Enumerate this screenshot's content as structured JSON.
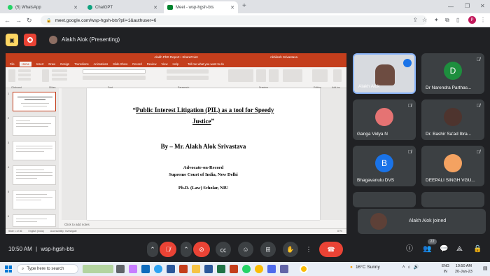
{
  "browser": {
    "tabs": [
      {
        "title": "(5) WhatsApp"
      },
      {
        "title": "ChatGPT"
      },
      {
        "title": "Meet - wsp-hgsh-bts"
      }
    ],
    "url": "meet.google.com/wsp-hgsh-bts?pli=1&authuser=6",
    "profile_initial": "P"
  },
  "meet": {
    "presenter_title": "Alakh Alok (Presenting)",
    "time": "10:50 AM",
    "meeting_code": "wsp-hgsh-bts",
    "participant_count": "22",
    "toast_text": "Alakh Alok joined",
    "participants": [
      {
        "name": "Alakh Alok",
        "type": "video"
      },
      {
        "name": "Dr Narendra Parthas...",
        "initial": "D",
        "color": "#1e8e3e"
      },
      {
        "name": "Ganga Vidya N",
        "type": "photo"
      },
      {
        "name": "Dr. Bashir Sa'ad Ibra...",
        "type": "photo"
      },
      {
        "name": "Bhagavanulu DVS",
        "initial": "B",
        "color": "#1a73e8"
      },
      {
        "name": "DEEPALI SINGH VGU...",
        "type": "photo"
      }
    ]
  },
  "ppt": {
    "window_title": "Alakh PhD Report • SharePoint",
    "user": "Akhilesh Srivastava",
    "menu": [
      "File",
      "Home",
      "Insert",
      "Draw",
      "Design",
      "Transitions",
      "Animations",
      "Slide Show",
      "Record",
      "Review",
      "View",
      "Help"
    ],
    "tell_me": "Tell me what you want to do",
    "groups": [
      "Clipboard",
      "Slides",
      "Font",
      "Paragraph",
      "Drawing",
      "Editing",
      "Add-ins"
    ],
    "slide": {
      "title_line1": "Public Interest Litigation (PIL) as a tool for Speedy",
      "title_line2": "Justice",
      "byline": "By – Mr. Alakh Alok Srivastava",
      "line1": "Advocate-on-Record",
      "line2": "Supreme Court of India, New Delhi",
      "line3": "Ph.D. (Law) Scholar, NIU"
    },
    "notes_placeholder": "Click to add notes",
    "status_left": "Slide 1 of 36",
    "status_lang": "English (India)",
    "status_access": "Accessibility: Investigate",
    "zoom": "87%"
  },
  "taskbar": {
    "search_placeholder": "Type here to search",
    "weather": "16°C  Sunny",
    "lang_top": "ENG",
    "lang_bottom": "IN",
    "clock_time": "10:50 AM",
    "clock_date": "20-Jan-23"
  }
}
